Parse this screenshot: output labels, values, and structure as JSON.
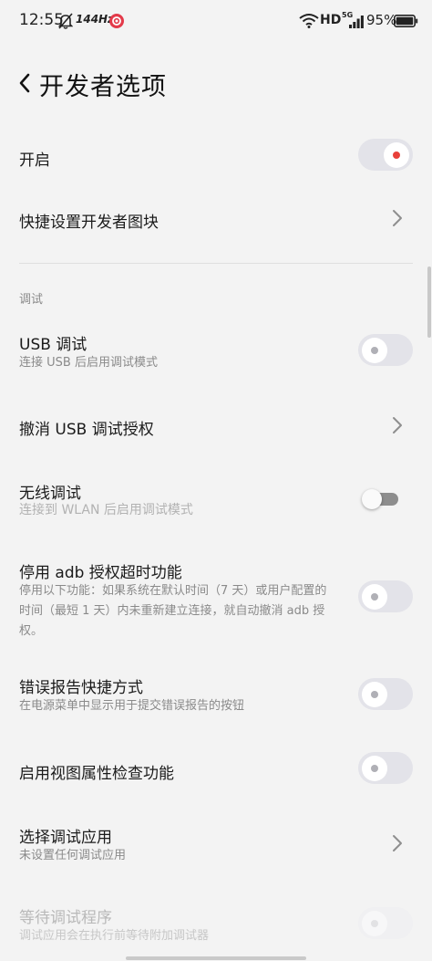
{
  "status_bar": {
    "time": "12:55",
    "refresh_rate": "144Hz",
    "hd_label": "HD",
    "network": "5G",
    "battery": "95%"
  },
  "header": {
    "title": "开发者选项"
  },
  "rows": {
    "enable": {
      "title": "开启",
      "toggle": "on"
    },
    "quick_tiles": {
      "title": "快捷设置开发者图块"
    },
    "usb_debug": {
      "title": "USB 调试",
      "subtitle": "连接 USB 后启用调试模式",
      "toggle": "off"
    },
    "revoke_usb": {
      "title": "撤消 USB 调试授权"
    },
    "wireless_debug": {
      "title": "无线调试",
      "subtitle": "连接到 WLAN 后启用调试模式",
      "toggle": "off"
    },
    "adb_timeout": {
      "title": "停用 adb 授权超时功能",
      "subtitle": "停用以下功能：如果系统在默认时间（7 天）或用户配置的时间（最短 1 天）内未重新建立连接，就自动撤消 adb 授权。",
      "toggle": "off"
    },
    "bug_report": {
      "title": "错误报告快捷方式",
      "subtitle": "在电源菜单中显示用于提交错误报告的按钮",
      "toggle": "off"
    },
    "view_attr": {
      "title": "启用视图属性检查功能",
      "toggle": "off"
    },
    "debug_app": {
      "title": "选择调试应用",
      "subtitle": "未设置任何调试应用"
    },
    "wait_debugger": {
      "title": "等待调试程序",
      "subtitle": "调试应用会在执行前等待附加调试器",
      "toggle": "disabled"
    }
  },
  "sections": {
    "debug": "调试"
  },
  "colors": {
    "accent": "#e8403a",
    "background": "#f3f3f3",
    "toggle_track": "#e3e3e9"
  }
}
